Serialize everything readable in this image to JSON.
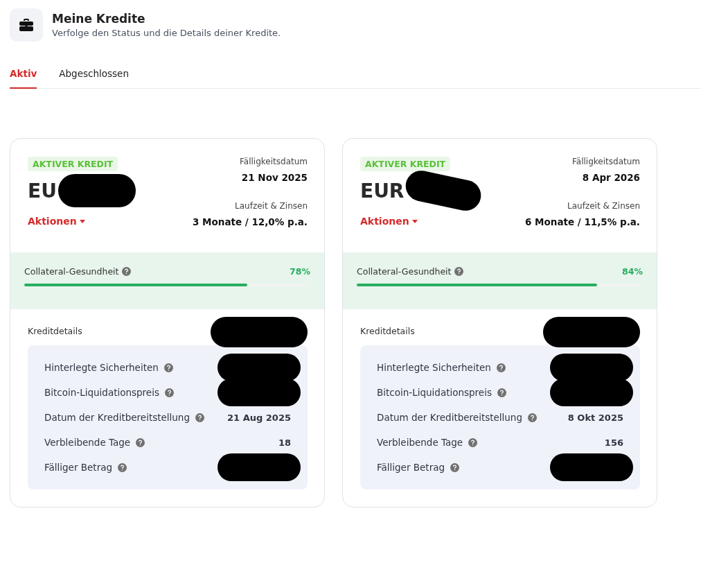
{
  "header": {
    "title": "Meine Kredite",
    "subtitle": "Verfolge den Status und die Details deiner Kredite."
  },
  "tabs": [
    {
      "label": "Aktiv",
      "selected": true
    },
    {
      "label": "Abgeschlossen",
      "selected": false
    }
  ],
  "loans": [
    {
      "badge": "AKTIVER KREDIT",
      "amount": "EU",
      "amount_redacted": true,
      "actions": "Aktionen",
      "due_label": "Fälligkeitsdatum",
      "due_date": "21 Nov 2025",
      "term_label": "Laufzeit & Zinsen",
      "term": "3 Monate / 12,0% p.a.",
      "health_label": "Collateral-Gesundheit",
      "health_value": "78%",
      "level": 0.78,
      "details_title": "Kreditdetails",
      "details_redacted": true,
      "rows": [
        {
          "label": "Hinterlegte Sicherheiten",
          "redacted": true
        },
        {
          "label": "Bitcoin-Liquidationspreis",
          "redacted": true
        },
        {
          "label": "Datum der Kreditbereitstellung",
          "value": "21 Aug 2025",
          "redacted": false
        },
        {
          "label": "Verbleibende Tage",
          "value": "18",
          "redacted": false
        },
        {
          "label": "Fälliger Betrag",
          "redacted": true
        }
      ]
    },
    {
      "badge": "AKTIVER KREDIT",
      "amount": "EUR",
      "amount_redacted": true,
      "actions": "Aktionen",
      "due_label": "Fälligkeitsdatum",
      "due_date": "8 Apr 2026",
      "term_label": "Laufzeit & Zinsen",
      "term": "6 Monate / 11,5% p.a.",
      "health_label": "Collateral-Gesundheit",
      "health_value": "84%",
      "level": 0.84,
      "details_title": "Kreditdetails",
      "details_redacted": true,
      "rows": [
        {
          "label": "Hinterlegte Sicherheiten",
          "redacted": true
        },
        {
          "label": "Bitcoin-Liquidationspreis",
          "redacted": true
        },
        {
          "label": "Datum der Kreditbereitstellung",
          "value": "8 Okt 2025",
          "redacted": false
        },
        {
          "label": "Verbleibende Tage",
          "value": "156",
          "redacted": false
        },
        {
          "label": "Fälliger Betrag",
          "redacted": true
        }
      ]
    }
  ]
}
